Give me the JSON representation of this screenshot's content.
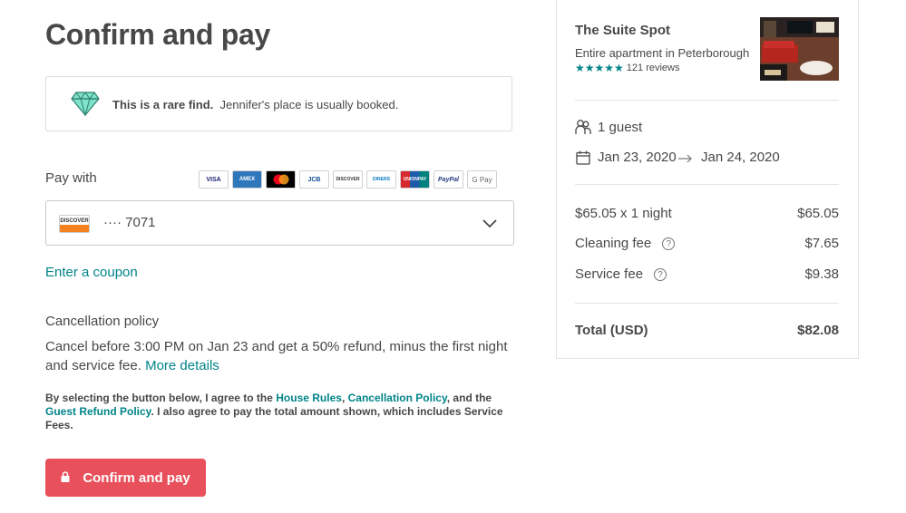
{
  "page": {
    "title": "Confirm and pay"
  },
  "rare_find": {
    "bold": "This is a rare find.",
    "text": "Jennifer's place is usually booked."
  },
  "payment": {
    "pay_with_label": "Pay with",
    "card_brands": [
      "VISA",
      "AMEX",
      "MC",
      "JCB",
      "DISCOVER",
      "DINERS",
      "UNIONPAY",
      "PayPal",
      "G Pay"
    ],
    "selected_card_brand": "DISCOVER",
    "selected_card_number": "···· 7071"
  },
  "coupon_link": "Enter a coupon",
  "cancellation": {
    "heading": "Cancellation policy",
    "text": "Cancel before 3:00 PM on Jan 23 and get a 50% refund, minus the first night and service fee.",
    "more_details": "More details"
  },
  "agreement": {
    "part1": "By selecting the button below, I agree to the ",
    "house_rules": "House Rules",
    "comma": ", ",
    "cancellation_policy": "Cancellation Policy",
    "part2": ", and the ",
    "guest_refund_policy": "Guest Refund Policy",
    "part3": ". I also agree to pay the total amount shown, which includes Service Fees."
  },
  "confirm_button": "Confirm and pay",
  "listing": {
    "name": "The Suite Spot",
    "subtitle": "Entire apartment in Peterborough",
    "stars": "★★★★★",
    "rating": 5,
    "reviews": "121 reviews"
  },
  "trip": {
    "guests": "1 guest",
    "check_in": "Jan 23, 2020",
    "check_out": "Jan 24, 2020"
  },
  "price": {
    "nightly_label": "$65.05 x 1 night",
    "nightly_value": "$65.05",
    "cleaning_label": "Cleaning fee",
    "cleaning_value": "$7.65",
    "service_label": "Service fee",
    "service_value": "$9.38",
    "help_glyph": "?",
    "total_label": "Total (USD)",
    "total_value": "$82.08"
  },
  "colors": {
    "accent": "#008489",
    "button": "#e8505b",
    "text": "#484848"
  }
}
